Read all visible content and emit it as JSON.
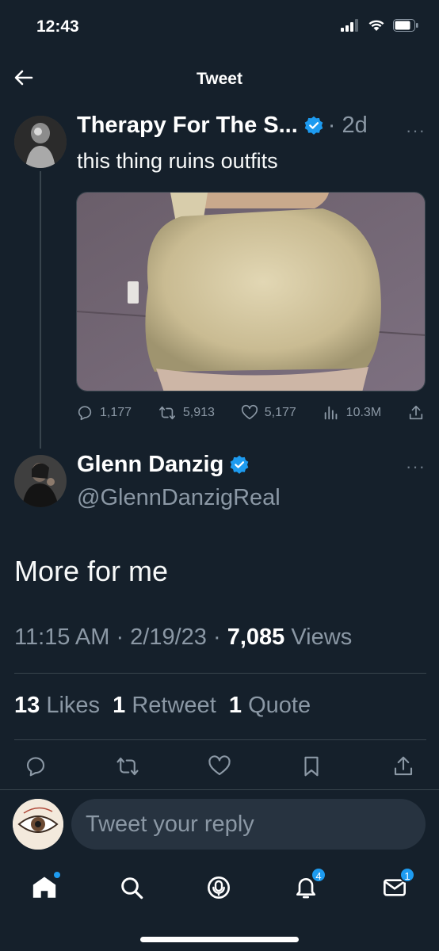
{
  "status_bar": {
    "time": "12:43"
  },
  "nav": {
    "title": "Tweet"
  },
  "quoted_tweet": {
    "name": "Therapy For The S...",
    "time": "· 2d",
    "text": "this thing ruins outfits",
    "replies": "1,177",
    "retweets": "5,913",
    "likes": "5,177",
    "views": "10.3M"
  },
  "main_tweet": {
    "name": "Glenn Danzig",
    "handle": "@GlennDanzigReal",
    "text": "More for me",
    "time": "11:15 AM",
    "date": "2/19/23",
    "views_count": "7,085",
    "views_label": "Views",
    "likes_count": "13",
    "likes_label": "Likes",
    "retweets_count": "1",
    "retweets_label": "Retweet",
    "quotes_count": "1",
    "quotes_label": "Quote"
  },
  "composer": {
    "placeholder": "Tweet your reply"
  },
  "tabbar": {
    "notifications_badge": "4",
    "messages_badge": "1"
  },
  "colors": {
    "background": "#15202b",
    "accent": "#1d9bf0",
    "muted": "#8b98a5"
  }
}
